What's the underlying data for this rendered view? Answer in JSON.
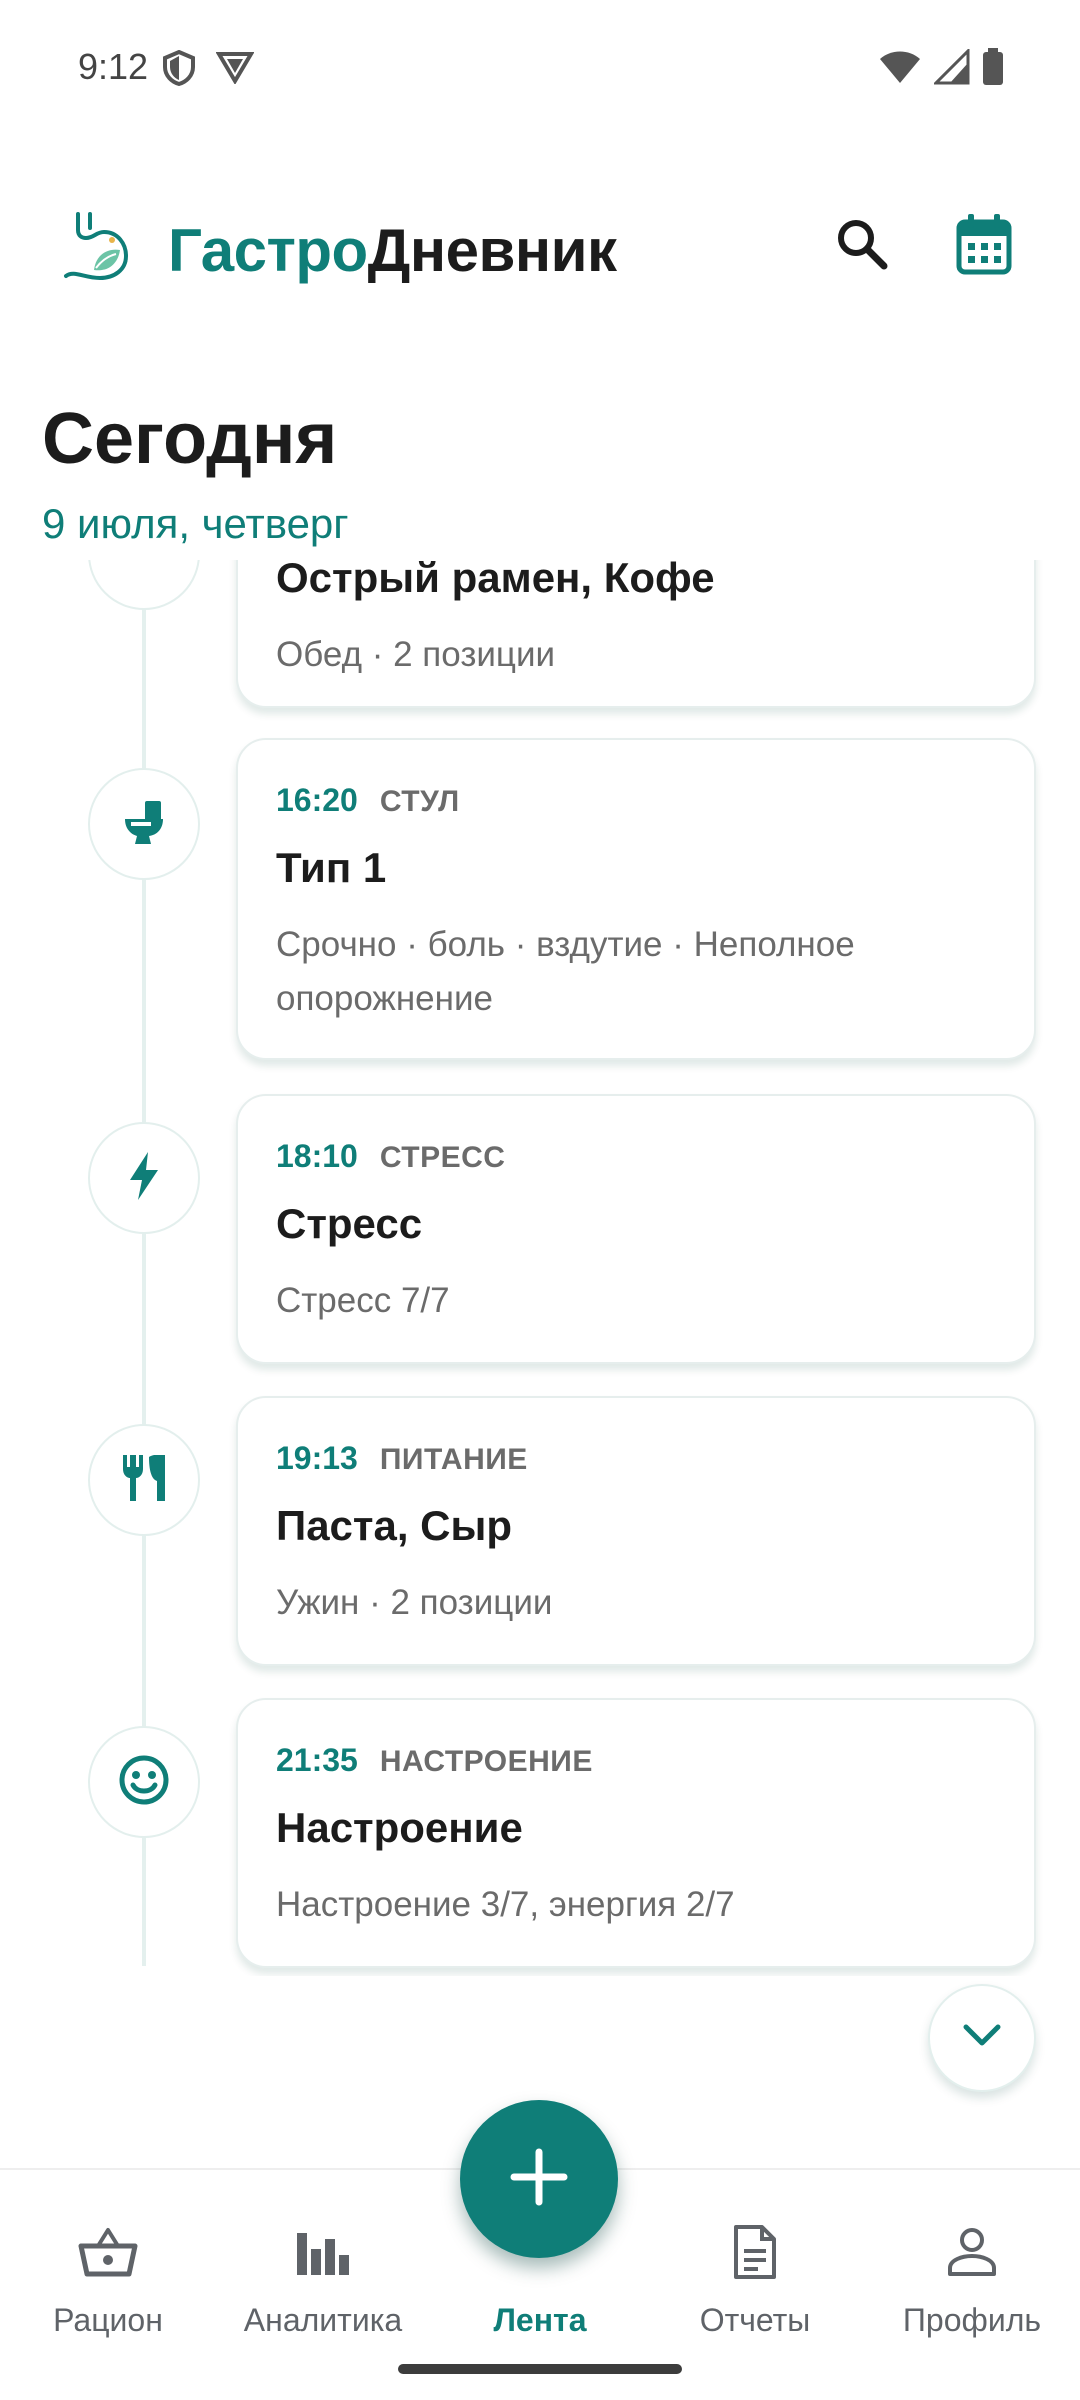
{
  "status_bar": {
    "time": "9:12"
  },
  "app_bar": {
    "title_part1": "Гастро",
    "title_part2": "Дневник"
  },
  "header": {
    "title": "Сегодня",
    "date": "9 июля, четверг"
  },
  "timeline": [
    {
      "icon": "food-icon",
      "time": "",
      "kind": "",
      "title": "Острый рамен, Кофе",
      "detail": "Обед · 2 позиции"
    },
    {
      "icon": "toilet-icon",
      "time": "16:20",
      "kind": "СТУЛ",
      "title": "Тип 1",
      "detail": "Срочно · боль · вздутие · Неполное опорожнение"
    },
    {
      "icon": "bolt-icon",
      "time": "18:10",
      "kind": "СТРЕСС",
      "title": "Стресс",
      "detail": "Стресс 7/7"
    },
    {
      "icon": "restaurant-icon",
      "time": "19:13",
      "kind": "ПИТАНИЕ",
      "title": "Паста, Сыр",
      "detail": "Ужин · 2 позиции"
    },
    {
      "icon": "smile-icon",
      "time": "21:35",
      "kind": "НАСТРОЕНИЕ",
      "title": "Настроение",
      "detail": "Настроение 3/7, энергия 2/7"
    }
  ],
  "bottom_nav": {
    "items": [
      {
        "label": "Рацион",
        "icon": "basket-icon",
        "active": false
      },
      {
        "label": "Аналитика",
        "icon": "bar-chart-icon",
        "active": false
      },
      {
        "label": "Лента",
        "icon": "",
        "active": true
      },
      {
        "label": "Отчеты",
        "icon": "document-icon",
        "active": false
      },
      {
        "label": "Профиль",
        "icon": "person-icon",
        "active": false
      }
    ]
  },
  "colors": {
    "accent": "#0f7e78",
    "text_primary": "#1c1c1c",
    "text_secondary": "#6b6b6b"
  }
}
